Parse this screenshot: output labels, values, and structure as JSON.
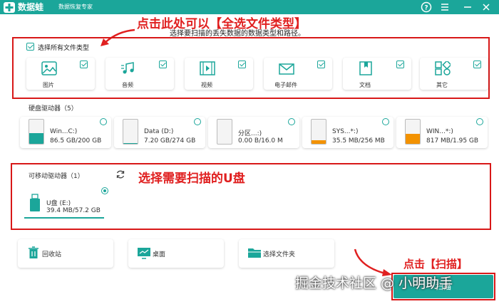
{
  "app": {
    "name": "数据蛙",
    "subtitle": "数据恢复专家"
  },
  "colors": {
    "accent": "#1ba69a",
    "annotation": "#e02020",
    "orange": "#f39200"
  },
  "annotations": {
    "select_all_tip": "点击此处可以【全选文件类型】",
    "usb_tip": "选择需要扫描的U盘",
    "scan_tip": "点击【扫描】"
  },
  "filetypes": {
    "subtitle": "选择要扫描的丢失数据的数据类型和路径。",
    "select_all_label": "选择所有文件类型",
    "items": [
      {
        "label": "图片",
        "icon": "image-icon"
      },
      {
        "label": "音频",
        "icon": "music-icon"
      },
      {
        "label": "视频",
        "icon": "video-icon"
      },
      {
        "label": "电子邮件",
        "icon": "email-icon"
      },
      {
        "label": "文档",
        "icon": "document-icon"
      },
      {
        "label": "其它",
        "icon": "other-icon"
      }
    ]
  },
  "hard_drives": {
    "title": "硬盘驱动器（5）",
    "items": [
      {
        "name": "Win...C:)",
        "size": "86.5 GB/200 GB",
        "fill_fraction": 0.43
      },
      {
        "name": "Data (D:)",
        "size": "7.20 GB/274 GB",
        "fill_fraction": 0.03
      },
      {
        "name": "分区...:)",
        "size": "0.00  B/16.0 M",
        "fill_fraction": 0.0
      },
      {
        "name": "SYS...*:)",
        "size": "35.5 MB/256 MB",
        "fill_fraction": 0.14
      },
      {
        "name": "WIN...*:)",
        "size": "817 MB/1.95 GB",
        "fill_fraction": 0.42
      }
    ]
  },
  "removable": {
    "title": "可移动驱动器（1）",
    "items": [
      {
        "name": "U盘 (E:)",
        "size": "39.4 MB/57.2 GB"
      }
    ]
  },
  "locations": [
    {
      "label": "回收站",
      "icon": "recycle-bin-icon"
    },
    {
      "label": "桌面",
      "icon": "desktop-icon"
    },
    {
      "label": "选择文件夹",
      "icon": "folder-icon"
    }
  ],
  "scan_button": "扫描",
  "watermark": "掘金技术社区 @ 小明助手"
}
